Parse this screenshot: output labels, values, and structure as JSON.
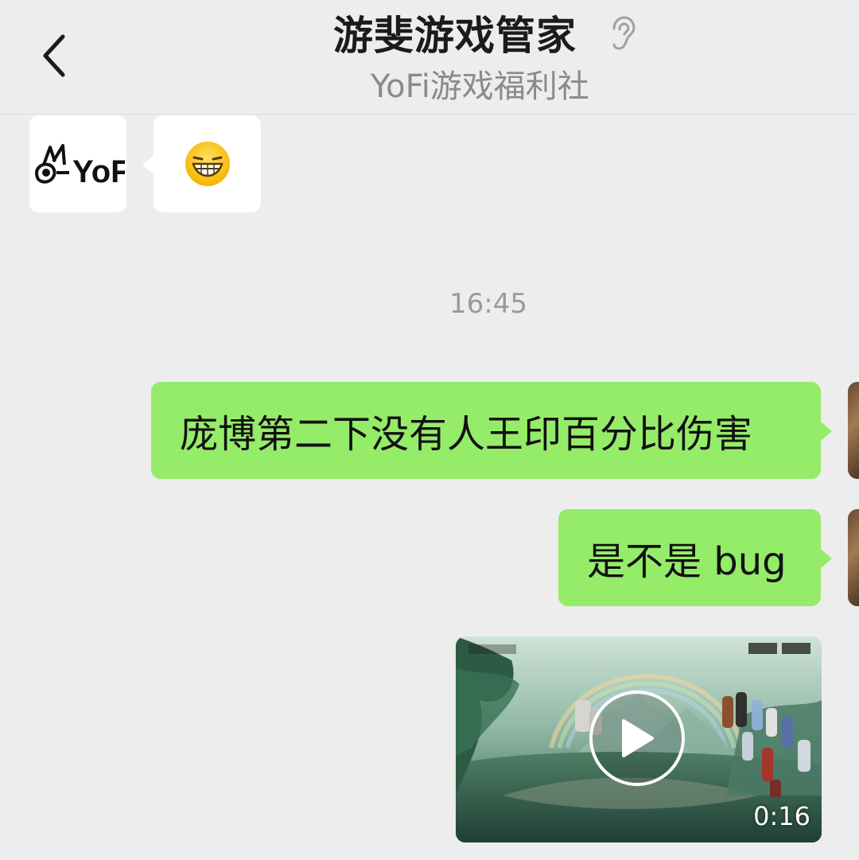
{
  "header": {
    "title": "游斐游戏管家",
    "subtitle": "YoFi游戏福利社",
    "back_icon": "chevron-left-icon",
    "listen_icon": "ear-icon"
  },
  "incoming": {
    "avatar_text": "YoFi",
    "emoji": "😁"
  },
  "timestamp": "16:45",
  "outgoing": [
    {
      "text": "庞博第二下没有人王印百分比伤害"
    },
    {
      "text": "是不是 bug"
    }
  ],
  "video": {
    "duration": "0:16",
    "play_icon": "play-icon"
  },
  "colors": {
    "background": "#ededed",
    "bubble_out": "#95ec69",
    "bubble_in": "#ffffff"
  }
}
